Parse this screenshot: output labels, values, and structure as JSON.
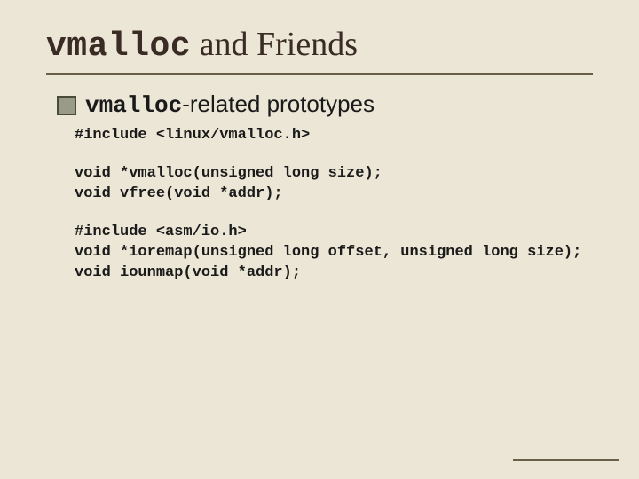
{
  "title": {
    "mono": "vmalloc",
    "rest": " and Friends"
  },
  "bullet": {
    "mono": "vmalloc",
    "rest": "-related prototypes"
  },
  "code1": "#include <linux/vmalloc.h>",
  "code2": "void *vmalloc(unsigned long size);\nvoid vfree(void *addr);",
  "code3": "#include <asm/io.h>\nvoid *ioremap(unsigned long offset, unsigned long size);\nvoid iounmap(void *addr);"
}
